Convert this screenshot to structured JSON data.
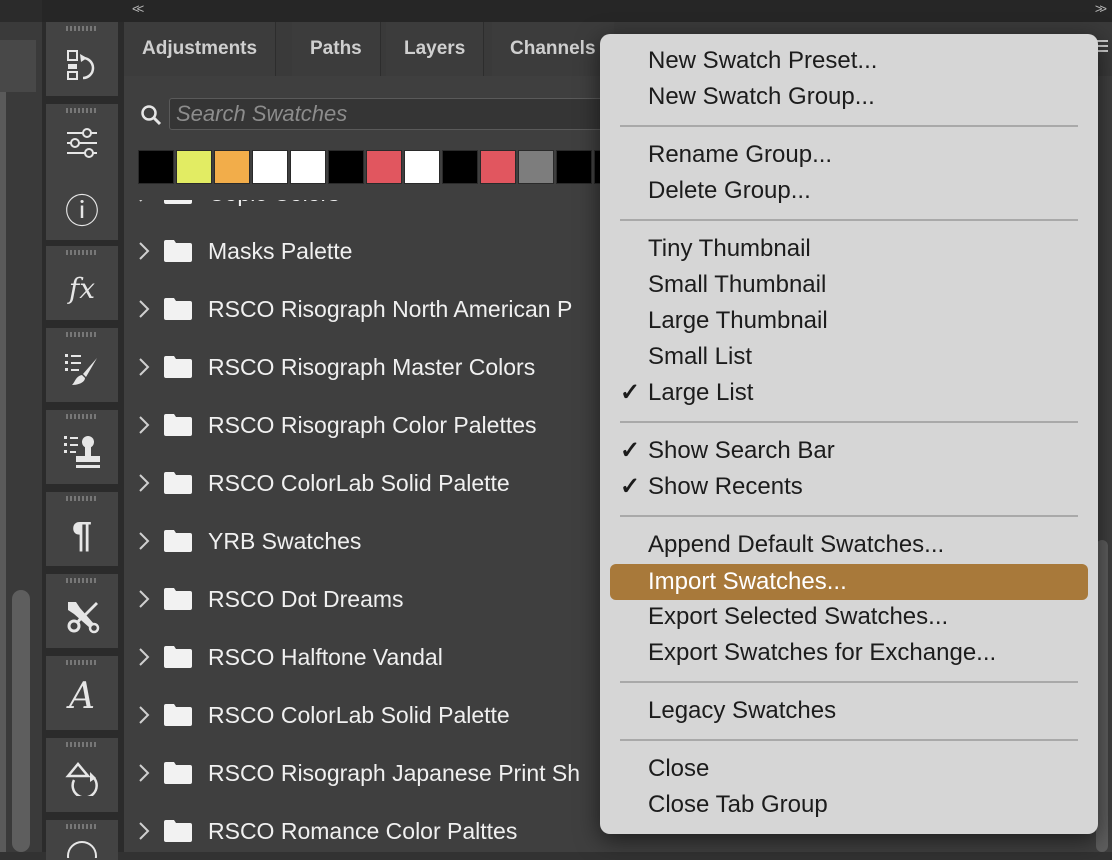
{
  "tabs": [
    "Adjustments",
    "Paths",
    "Layers",
    "Channels"
  ],
  "search": {
    "placeholder": "Search Swatches"
  },
  "recent_swatch_colors": [
    "#000000",
    "#e2ec63",
    "#f2ad4a",
    "#ffffff",
    "#ffffff",
    "#000000",
    "#e1565f",
    "#ffffff",
    "#000000",
    "#e1565f",
    "#7d7d7d",
    "#000000",
    "#000000"
  ],
  "swatch_groups": [
    "Copic Colors",
    "Masks Palette",
    "RSCO Risograph North American P",
    "RSCO Risograph Master Colors",
    "RSCO Risograph Color Palettes",
    "RSCO ColorLab Solid Palette",
    "YRB Swatches",
    "RSCO Dot Dreams",
    "RSCO Halftone Vandal",
    "RSCO ColorLab Solid Palette",
    "RSCO Risograph Japanese Print Sh",
    "RSCO Romance Color Palttes"
  ],
  "menu": {
    "new_swatch_preset": "New Swatch Preset...",
    "new_swatch_group": "New Swatch Group...",
    "rename_group": "Rename Group...",
    "delete_group": "Delete Group...",
    "tiny_thumbnail": "Tiny Thumbnail",
    "small_thumbnail": "Small Thumbnail",
    "large_thumbnail": "Large Thumbnail",
    "small_list": "Small List",
    "large_list": "Large List",
    "show_search_bar": "Show Search Bar",
    "show_recents": "Show Recents",
    "append_default": "Append Default Swatches...",
    "import_swatches": "Import Swatches...",
    "export_selected": "Export Selected Swatches...",
    "export_exchange": "Export Swatches for Exchange...",
    "legacy_swatches": "Legacy Swatches",
    "close": "Close",
    "close_tab_group": "Close Tab Group",
    "check_glyph": "✓",
    "highlight_color": "#a8793a"
  },
  "toolbar": {
    "info_glyph": "ⓘ",
    "fx_glyph": "fx",
    "paragraph_glyph": "¶",
    "character_glyph": "A",
    "collapse_left": "<<",
    "collapse_right": ">>"
  }
}
